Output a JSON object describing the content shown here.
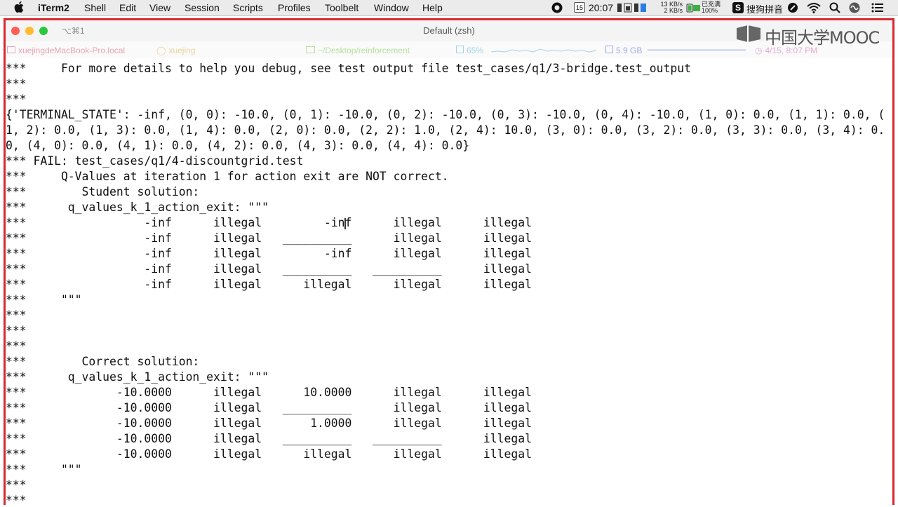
{
  "menubar": {
    "app": "iTerm2",
    "items": [
      "Shell",
      "Edit",
      "View",
      "Session",
      "Scripts",
      "Profiles",
      "Toolbelt",
      "Window",
      "Help"
    ],
    "calendar_day": "15",
    "clock": "20:07",
    "net_up": "13 KB/s",
    "net_down": "2 KB/s",
    "battery_status": "已充满",
    "battery_pct": "100%",
    "input_method": "搜狗拼音"
  },
  "window": {
    "shortcut": "⌥⌘1",
    "title": "Default (zsh)"
  },
  "statusbar": {
    "host": "xuejingdeMacBook-Pro.local",
    "user": "xuejing",
    "path": "~/Desktop/reinforcement",
    "cpu": "65%",
    "mem": "5.9 GB",
    "datetime": "4/15, 8:07 PM"
  },
  "watermark": "中国大学MOOC",
  "terminal": {
    "lines": [
      "***     For more details to help you debug, see test output file test_cases/q1/3-bridge.test_output",
      "***",
      "***",
      "{'TERMINAL_STATE': -inf, (0, 0): -10.0, (0, 1): -10.0, (0, 2): -10.0, (0, 3): -10.0, (0, 4): -10.0, (1, 0): 0.0, (1, 1): 0.0, (",
      "1, 2): 0.0, (1, 3): 0.0, (1, 4): 0.0, (2, 0): 0.0, (2, 2): 1.0, (2, 4): 10.0, (3, 0): 0.0, (3, 2): 0.0, (3, 3): 0.0, (3, 4): 0.",
      "0, (4, 0): 0.0, (4, 1): 0.0, (4, 2): 0.0, (4, 3): 0.0, (4, 4): 0.0}",
      "*** FAIL: test_cases/q1/4-discountgrid.test",
      "***     Q-Values at iteration 1 for action exit are NOT correct.",
      "***        Student solution:",
      "***      q_values_k_1_action_exit: \"\"\"",
      "***                 -inf      illegal         -inf      illegal      illegal",
      "***                 -inf      illegal   __________      illegal      illegal",
      "***                 -inf      illegal         -inf      illegal      illegal",
      "***                 -inf      illegal   __________   __________      illegal",
      "***                 -inf      illegal      illegal      illegal      illegal",
      "***     \"\"\"",
      "***",
      "***",
      "***",
      "***        Correct solution:",
      "***      q_values_k_1_action_exit: \"\"\"",
      "***             -10.0000      illegal      10.0000      illegal      illegal",
      "***             -10.0000      illegal   __________      illegal      illegal",
      "***             -10.0000      illegal       1.0000      illegal      illegal",
      "***             -10.0000      illegal   __________   __________      illegal",
      "***             -10.0000      illegal      illegal      illegal      illegal",
      "***     \"\"\"",
      "***",
      "***"
    ]
  }
}
